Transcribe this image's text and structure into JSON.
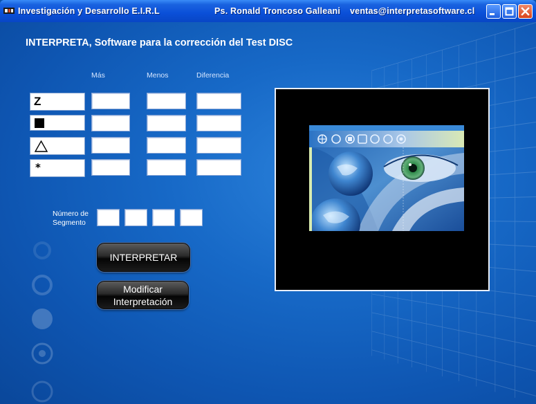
{
  "window": {
    "title_left": "Investigación y Desarrollo E.I.R.L",
    "title_author": "Ps. Ronald Troncoso Galleani",
    "title_email": "ventas@interpretasoftware.cl"
  },
  "heading": "INTERPRETA, Software para la corrección del Test DISC",
  "columns": {
    "mas": "Más",
    "menos": "Menos",
    "diferencia": "Diferencia"
  },
  "rows": [
    {
      "symbol": "Z",
      "icon": "letter-z",
      "mas": "",
      "menos": "",
      "diferencia": ""
    },
    {
      "symbol": "",
      "icon": "black-square-icon",
      "mas": "",
      "menos": "",
      "diferencia": ""
    },
    {
      "symbol": "",
      "icon": "triangle-outline-icon",
      "mas": "",
      "menos": "",
      "diferencia": ""
    },
    {
      "symbol": "*",
      "icon": "star-icon",
      "mas": "",
      "menos": "",
      "diferencia": ""
    }
  ],
  "segment": {
    "label_line1": "Número de",
    "label_line2": "Segmento",
    "values": [
      "",
      "",
      "",
      ""
    ]
  },
  "buttons": {
    "interpretar": "INTERPRETAR",
    "modificar_line1": "Modificar",
    "modificar_line2": "Interpretación"
  }
}
